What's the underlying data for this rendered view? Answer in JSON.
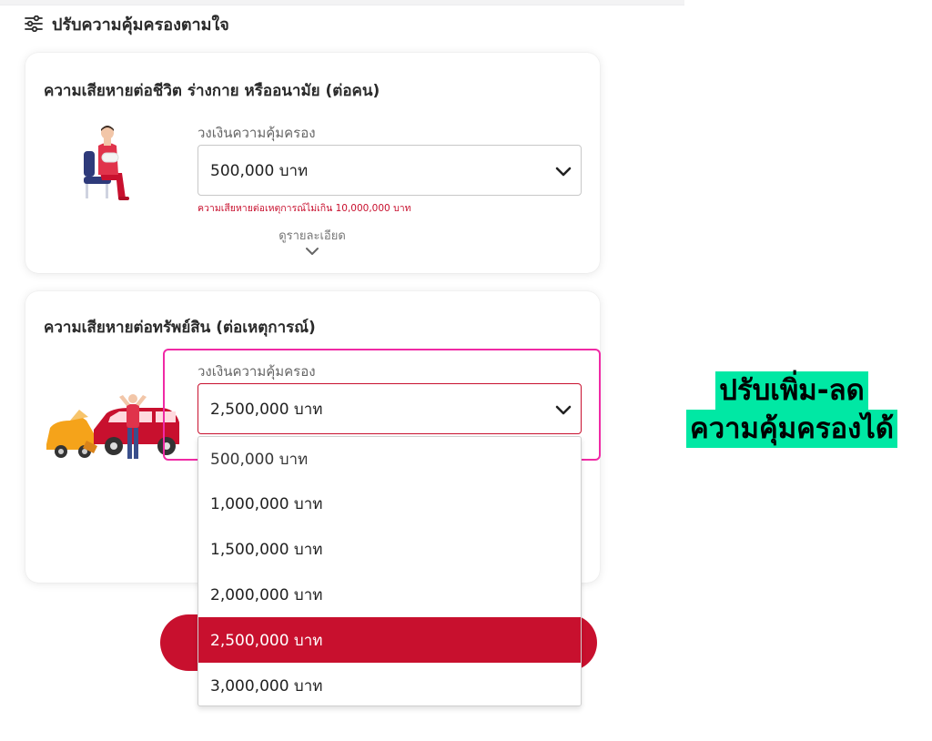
{
  "section": {
    "title": "ปรับความคุ้มครองตามใจ",
    "icon": "sliders-icon"
  },
  "bodily_injury_card": {
    "title": "ความเสียหายต่อชีวิต ร่างกาย หรืออนามัย (ต่อคน)",
    "field_label": "วงเงินความคุ้มครอง",
    "selected_value": "500,000 บาท",
    "helper_text": "ความเสียหายต่อเหตุการณ์ไม่เกิน 10,000,000 บาท",
    "details_link": "ดูรายละเอียด"
  },
  "property_damage_card": {
    "title": "ความเสียหายต่อทรัพย์สิน (ต่อเหตุการณ์)",
    "field_label": "วงเงินความคุ้มครอง",
    "selected_value": "2,500,000 บาท",
    "options": [
      "500,000 บาท",
      "1,000,000 บาท",
      "1,500,000 บาท",
      "2,000,000 บาท",
      "2,500,000 บาท",
      "3,000,000 บาท"
    ],
    "selected_index": 4
  },
  "annotation": {
    "line1": "ปรับเพิ่ม-ลด",
    "line2": "ความคุ้มครองได้"
  },
  "colors": {
    "brand_red": "#c8102e",
    "highlight_pink": "#f02aa5",
    "annotation_green": "#00e8a4"
  }
}
